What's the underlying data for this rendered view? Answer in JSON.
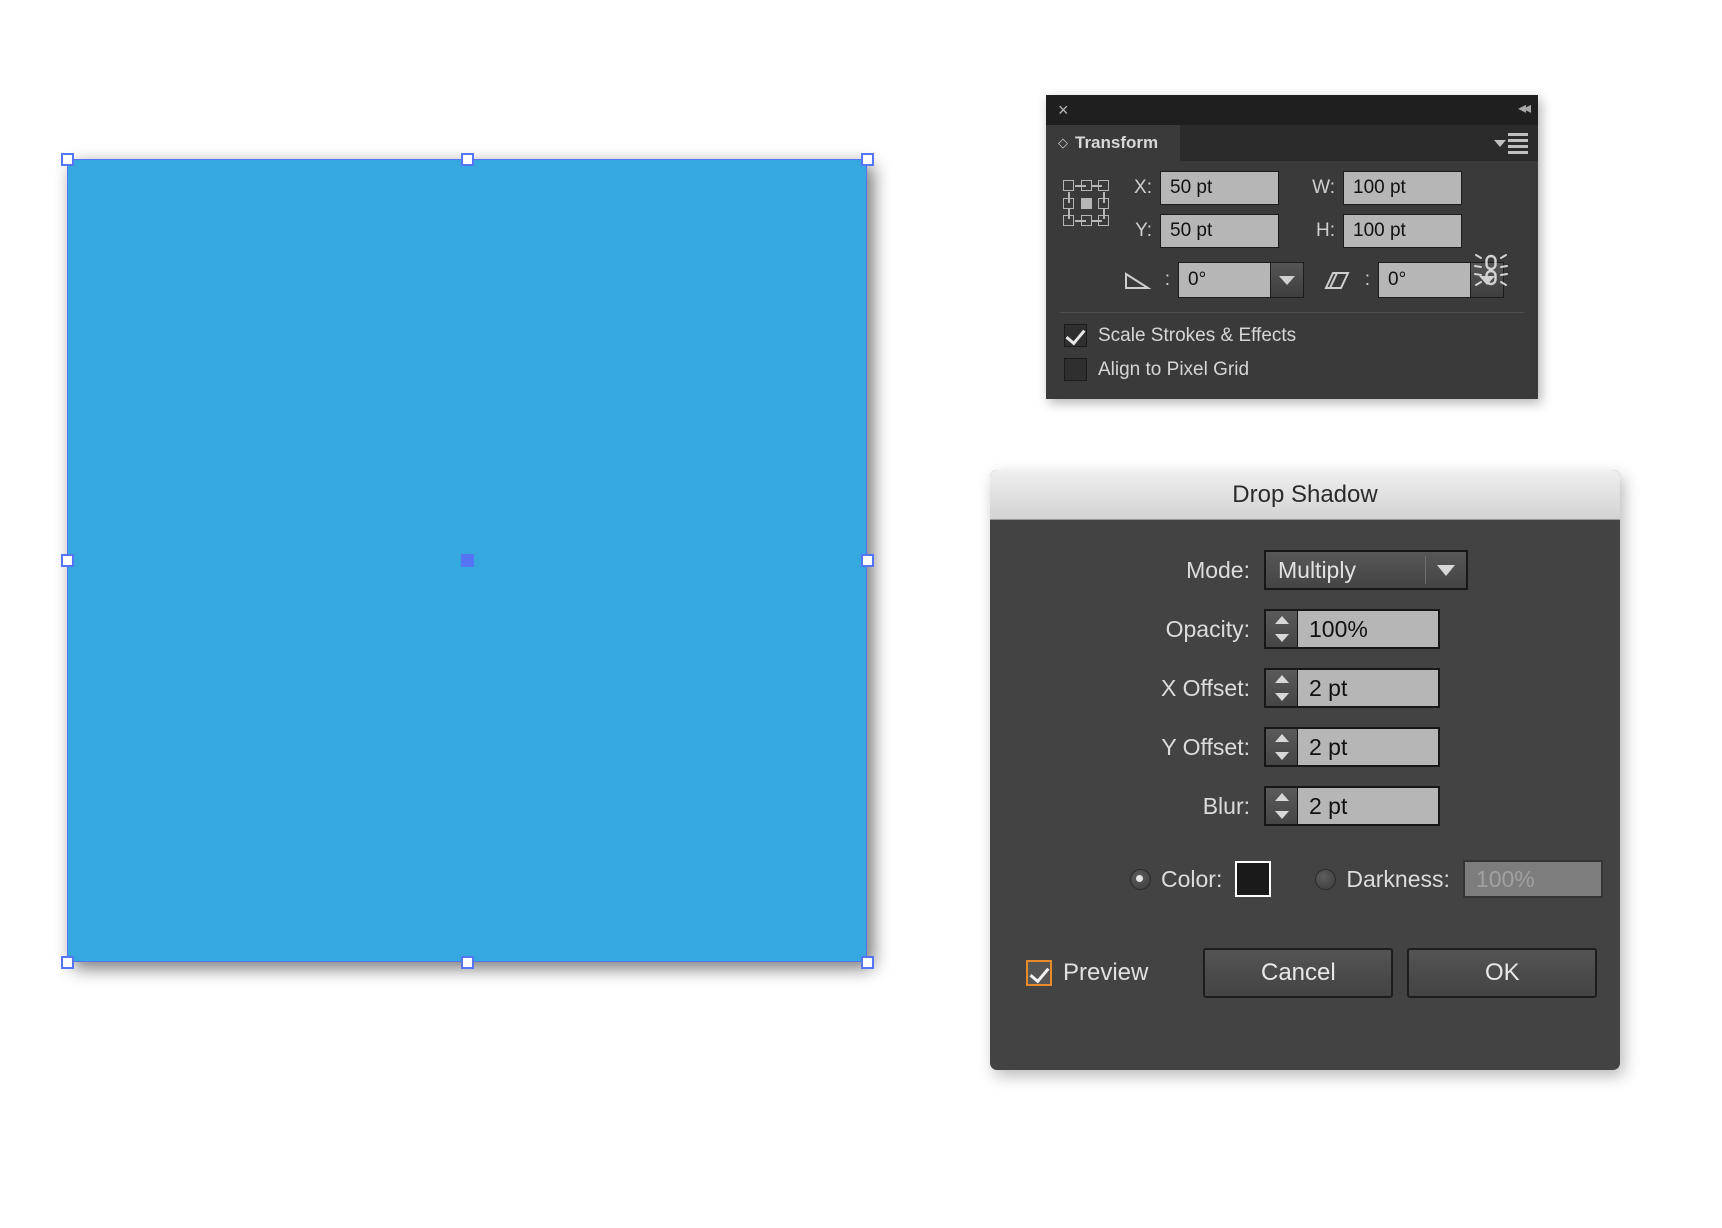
{
  "canvas": {
    "background_color": "#ffffff",
    "shape": {
      "name": "rectangle",
      "fill_color": "#34a8df",
      "selection_color": "#5575f5",
      "handle_fill": "#ffffff",
      "has_drop_shadow": true
    }
  },
  "transform_panel": {
    "close_icon": "×",
    "collapse_icon": "◂◂",
    "tab_diamond_icon": "◇",
    "tab_label": "Transform",
    "reference_point": "center",
    "fields": {
      "x_label": "X:",
      "x_value": "50 pt",
      "w_label": "W:",
      "w_value": "100 pt",
      "y_label": "Y:",
      "y_value": "50 pt",
      "h_label": "H:",
      "h_value": "100 pt",
      "rotate_label": ":",
      "rotate_value": "0°",
      "shear_label": ":",
      "shear_value": "0°"
    },
    "checkboxes": [
      {
        "label": "Scale Strokes & Effects",
        "checked": true
      },
      {
        "label": "Align to Pixel Grid",
        "checked": false
      }
    ]
  },
  "drop_shadow_dialog": {
    "title": "Drop Shadow",
    "mode_label": "Mode:",
    "mode_value": "Multiply",
    "opacity_label": "Opacity:",
    "opacity_value": "100%",
    "x_offset_label": "X Offset:",
    "x_offset_value": "2 pt",
    "y_offset_label": "Y Offset:",
    "y_offset_value": "2 pt",
    "blur_label": "Blur:",
    "blur_value": "2 pt",
    "color_label": "Color:",
    "color_selected": true,
    "color_swatch": "#1a1a1a",
    "darkness_label": "Darkness:",
    "darkness_selected": false,
    "darkness_value": "100%",
    "preview_label": "Preview",
    "preview_checked": true,
    "preview_focus_color": "#e8892b",
    "cancel_label": "Cancel",
    "ok_label": "OK"
  }
}
